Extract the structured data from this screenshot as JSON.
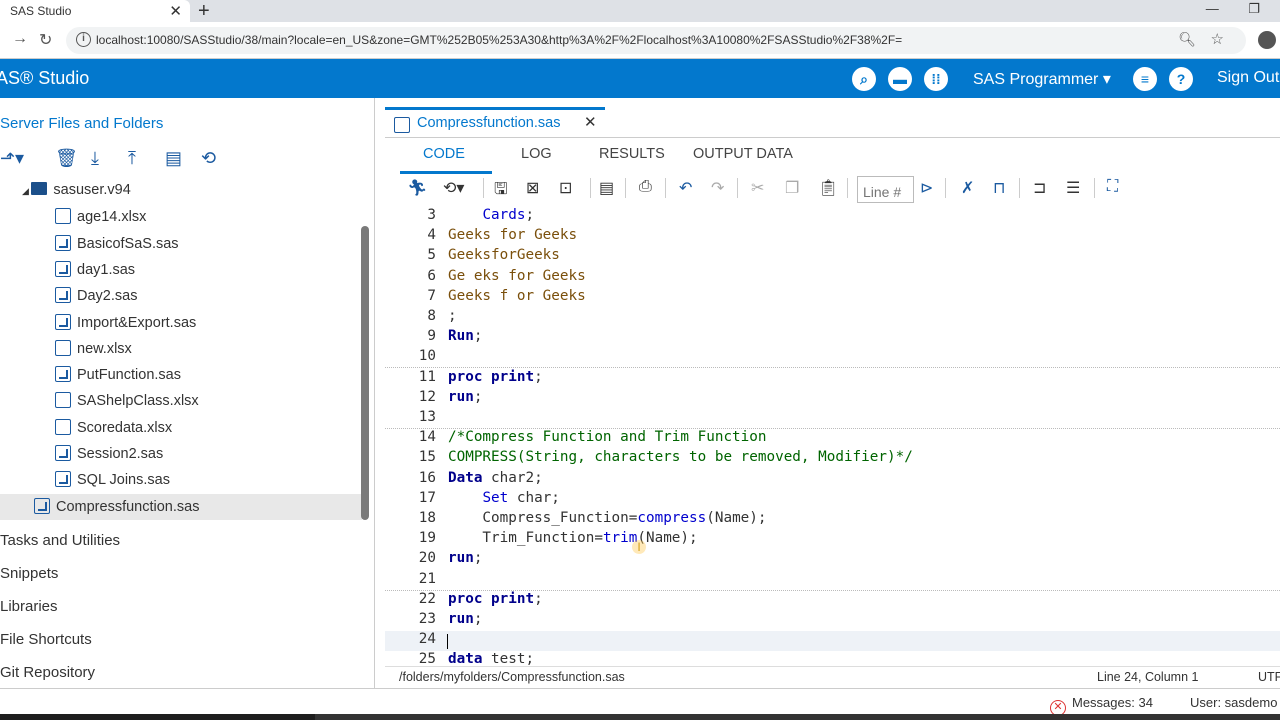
{
  "browser": {
    "tab_title": "SAS Studio",
    "tab_close": "✕",
    "new_tab": "+",
    "url": "localhost:10080/SASStudio/38/main?locale=en_US&zone=GMT%252B05%253A30&http%3A%2F%2Flocalhost%3A10080%2FSASStudio%2F38%2F=",
    "window_minimize": "—",
    "window_restore": "❐"
  },
  "app": {
    "title": "AS® Studio",
    "perspective": "SAS Programmer ▾",
    "sign_out": "Sign Out",
    "brand_color": "#0378cd"
  },
  "left_panel": {
    "title": "Server Files and Folders",
    "tree": [
      {
        "label": "sasuser.v94",
        "type": "folder",
        "icon": "folder-icon"
      },
      {
        "label": "age14.xlsx",
        "type": "xlsx",
        "icon": "excel-file-icon"
      },
      {
        "label": "BasicofSaS.sas",
        "type": "sas",
        "icon": "sas-program-icon"
      },
      {
        "label": "day1.sas",
        "type": "sas",
        "icon": "sas-program-icon"
      },
      {
        "label": "Day2.sas",
        "type": "sas",
        "icon": "sas-program-icon"
      },
      {
        "label": "Import&Export.sas",
        "type": "sas",
        "icon": "sas-program-icon"
      },
      {
        "label": "new.xlsx",
        "type": "xlsx",
        "icon": "excel-file-icon"
      },
      {
        "label": "PutFunction.sas",
        "type": "sas",
        "icon": "sas-program-icon"
      },
      {
        "label": "SAShelpClass.xlsx",
        "type": "xlsx",
        "icon": "excel-file-icon"
      },
      {
        "label": "Scoredata.xlsx",
        "type": "xlsx",
        "icon": "excel-file-icon"
      },
      {
        "label": "Session2.sas",
        "type": "sas",
        "icon": "sas-program-icon"
      },
      {
        "label": "SQL Joins.sas",
        "type": "sas",
        "icon": "sas-program-icon"
      },
      {
        "label": "Compressfunction.sas",
        "type": "sas",
        "icon": "sas-program-icon"
      }
    ],
    "sections": [
      "Tasks and Utilities",
      "Snippets",
      "Libraries",
      "File Shortcuts",
      "Git Repository"
    ]
  },
  "editor": {
    "tab_label": "Compressfunction.sas",
    "subtabs": [
      "CODE",
      "LOG",
      "RESULTS",
      "OUTPUT DATA"
    ],
    "line_placeholder": "Line #",
    "code_lines": [
      {
        "n": "3",
        "text": "    Cards;"
      },
      {
        "n": "4",
        "text": "Geeks for Geeks"
      },
      {
        "n": "5",
        "text": "GeeksforGeeks"
      },
      {
        "n": "6",
        "text": "Ge eks for Geeks"
      },
      {
        "n": "7",
        "text": "Geeks f or Geeks"
      },
      {
        "n": "8",
        "text": ";"
      },
      {
        "n": "9",
        "text": "Run;"
      },
      {
        "n": "10",
        "text": ""
      },
      {
        "n": "11",
        "text": "proc print;"
      },
      {
        "n": "12",
        "text": "run;"
      },
      {
        "n": "13",
        "text": ""
      },
      {
        "n": "14",
        "text": "/*Compress Function and Trim Function"
      },
      {
        "n": "15",
        "text": "COMPRESS(String, characters to be removed, Modifier)*/"
      },
      {
        "n": "16",
        "text": "Data char2;"
      },
      {
        "n": "17",
        "text": "    Set char;"
      },
      {
        "n": "18",
        "text": "    Compress_Function=compress(Name);"
      },
      {
        "n": "19",
        "text": "    Trim_Function=trim(Name);"
      },
      {
        "n": "20",
        "text": "run;"
      },
      {
        "n": "21",
        "text": ""
      },
      {
        "n": "22",
        "text": "proc print;"
      },
      {
        "n": "23",
        "text": "run;"
      },
      {
        "n": "24",
        "text": ""
      },
      {
        "n": "25",
        "text": "data test;"
      }
    ],
    "status_path": "/folders/myfolders/Compressfunction.sas",
    "status_position": "Line 24, Column 1",
    "status_encoding": "UTF"
  },
  "footer": {
    "messages": "Messages: 34",
    "user": "User: sasdemo"
  }
}
